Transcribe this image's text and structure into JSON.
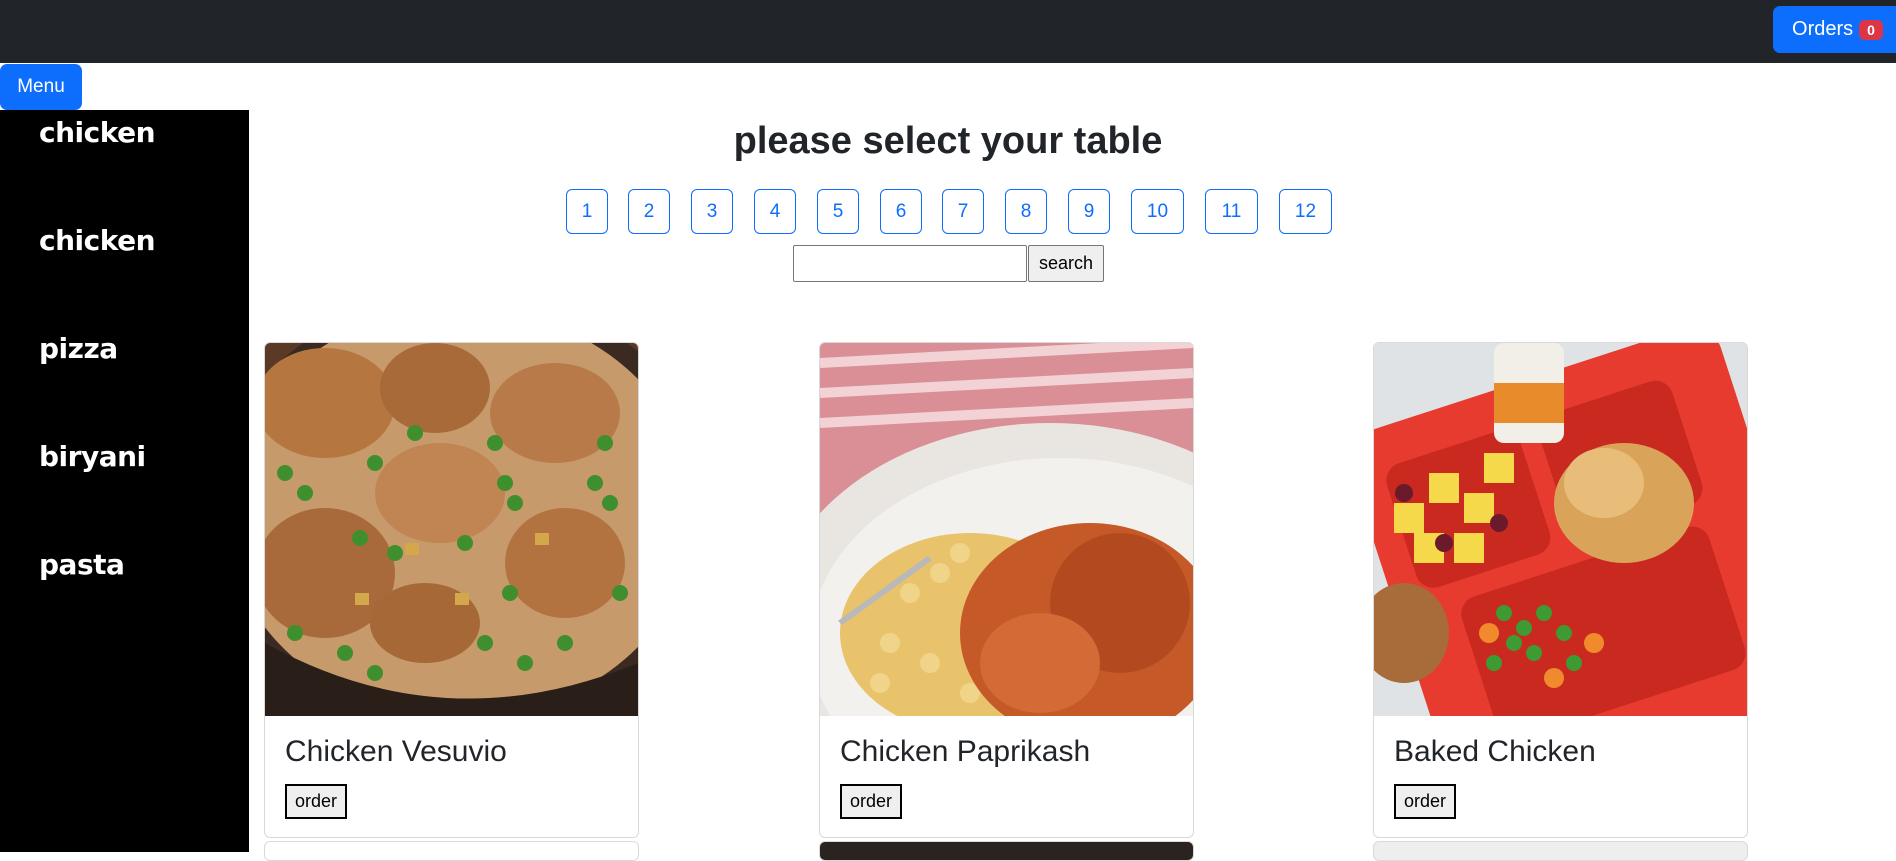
{
  "header": {
    "orders_label": "Orders",
    "orders_count": "0"
  },
  "menu_button": "Menu",
  "sidebar": {
    "items": [
      {
        "label": "chicken"
      },
      {
        "label": "chicken"
      },
      {
        "label": "pizza"
      },
      {
        "label": "biryani"
      },
      {
        "label": "pasta"
      }
    ]
  },
  "main": {
    "heading": "please select your table",
    "tables": [
      "1",
      "2",
      "3",
      "4",
      "5",
      "6",
      "7",
      "8",
      "9",
      "10",
      "11",
      "12"
    ],
    "search": {
      "value": "",
      "button_label": "search"
    },
    "cards": [
      {
        "title": "Chicken Vesuvio",
        "button_label": "order"
      },
      {
        "title": "Chicken Paprikash",
        "button_label": "order"
      },
      {
        "title": "Baked Chicken",
        "button_label": "order"
      }
    ]
  },
  "colors": {
    "navbar": "#212529",
    "primary": "#0d6efd",
    "badge": "#dc3545",
    "sidebar": "#000000"
  }
}
